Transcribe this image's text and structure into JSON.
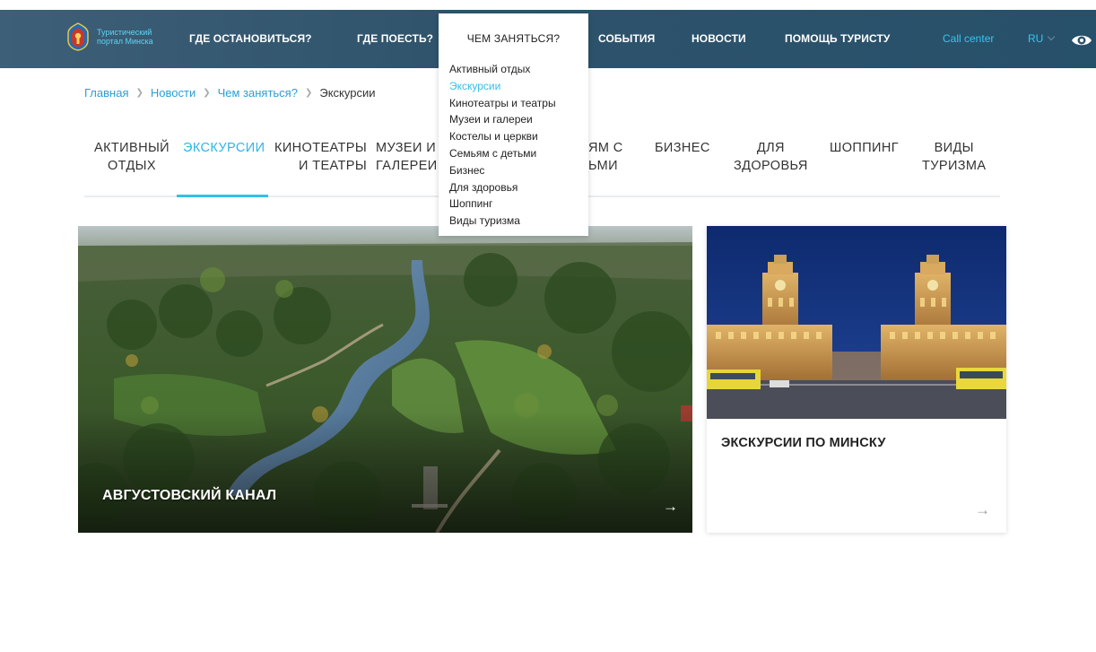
{
  "header": {
    "logo_line1": "Туристический",
    "logo_line2": "портал Минска",
    "nav": {
      "stay": "ГДЕ ОСТАНОВИТЬСЯ?",
      "eat": "ГДЕ ПОЕСТЬ?",
      "todo": "ЧЕМ ЗАНЯТЬСЯ?",
      "events": "СОБЫТИЯ",
      "news": "НОВОСТИ",
      "help": "ПОМОЩЬ ТУРИСТУ"
    },
    "call_center": "Call center",
    "lang": "RU",
    "eye_icon": "eye-icon"
  },
  "dropdown": {
    "title": "ЧЕМ ЗАНЯТЬСЯ?",
    "items": [
      "Активный отдых",
      "Экскурсии",
      "Кинотеатры и театры",
      "Музеи и галереи",
      "Костелы и церкви",
      "Семьям с детьми",
      "Бизнес",
      "Для здоровья",
      "Шоппинг",
      "Виды туризма"
    ],
    "active_index": 1
  },
  "breadcrumb": {
    "home": "Главная",
    "news": "Новости",
    "todo": "Чем заняться?",
    "current": "Экскурсии"
  },
  "tabs": {
    "active_l1": "АКТИВНЫЙ",
    "active_l2": "ОТДЫХ",
    "excursions": "ЭКСКУРСИИ",
    "cinema_l1": "КИНОТЕАТРЫ",
    "cinema_l2": "И ТЕАТРЫ",
    "museums_l1": "МУЗЕИ И",
    "museums_l2": "ГАЛЕРЕИ",
    "families_l1": "ЯМ С",
    "families_l2": "ЬМИ",
    "business": "БИЗНЕС",
    "health_l1": "ДЛЯ",
    "health_l2": "ЗДОРОВЬЯ",
    "shopping": "ШОППИНГ",
    "tourism_l1": "ВИДЫ",
    "tourism_l2": "ТУРИЗМА"
  },
  "cards": {
    "big": {
      "title": "АВГУСТОВСКИЙ КАНАЛ",
      "arrow": "→"
    },
    "small": {
      "title": "ЭКСКУРСИИ ПО МИНСКУ",
      "arrow": "→"
    }
  },
  "colors": {
    "header_bg": "#2f546c",
    "accent": "#34c6ef",
    "link": "#2a9fd6"
  }
}
